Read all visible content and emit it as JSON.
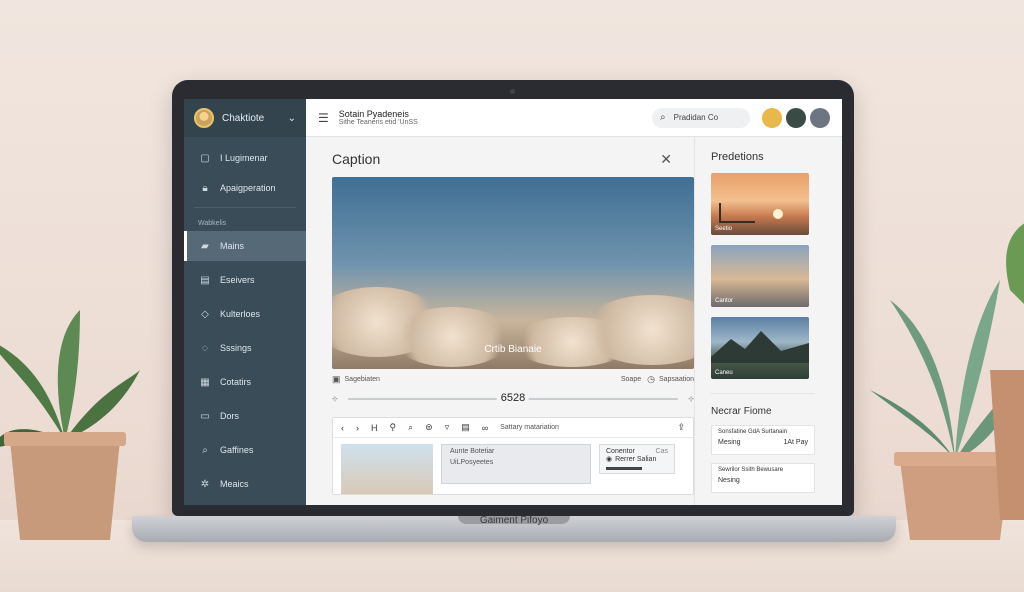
{
  "sidebar": {
    "title": "Chaktiote",
    "items": [
      {
        "label": "I Lugimenar",
        "icon": "document-icon"
      },
      {
        "label": "Apaigperation",
        "icon": "lock-icon"
      }
    ],
    "section": "Wabkelis",
    "nav": [
      {
        "label": "Mains",
        "icon": "image-icon",
        "active": true
      },
      {
        "label": "Eseivers",
        "icon": "file-icon"
      },
      {
        "label": "Kulterloes",
        "icon": "tag-icon"
      },
      {
        "label": "Sssings",
        "icon": "chat-icon"
      },
      {
        "label": "Cotatirs",
        "icon": "grid-icon"
      },
      {
        "label": "Dors",
        "icon": "folder-icon"
      },
      {
        "label": "Gaffines",
        "icon": "search-icon"
      },
      {
        "label": "Meaics",
        "icon": "gear-icon"
      }
    ]
  },
  "topbar": {
    "title": "Sotain Pyadeneis",
    "subtitle": "Sithe Teaneris etid 'UnSS",
    "search_label": "Pradidan Co"
  },
  "panel": {
    "title": "Caption",
    "hero_caption": "Crtib Bianaie",
    "media_left": "Sagebiaten",
    "media_right_a": "Soape",
    "media_right_b": "Sapsaation",
    "slider_value": "6528",
    "toolbar_label": "Sattary matariation",
    "card1_title": "Aunte Botetiar",
    "card1_sub": "UiLPosyeetes",
    "card2_title": "Conentor",
    "card2_badge": "Cas",
    "card2_sub": "Rerrer Salian"
  },
  "rail": {
    "title": "Predetions",
    "preds": [
      "Seetio",
      "Cantor",
      "Caneu"
    ],
    "recent_title": "Necrar Fiome",
    "recent": [
      {
        "title": "Sonsfatine GdA Surtanain",
        "who": "Mesing",
        "time": "1At Pay"
      },
      {
        "title": "Sewrilor Ssith Bewusare",
        "who": "Nesing",
        "time": ""
      }
    ]
  },
  "base_label": "Gaiment Pifoyo",
  "colors": {
    "sidebar": "#3b4c59",
    "accent": "#ffffff"
  }
}
